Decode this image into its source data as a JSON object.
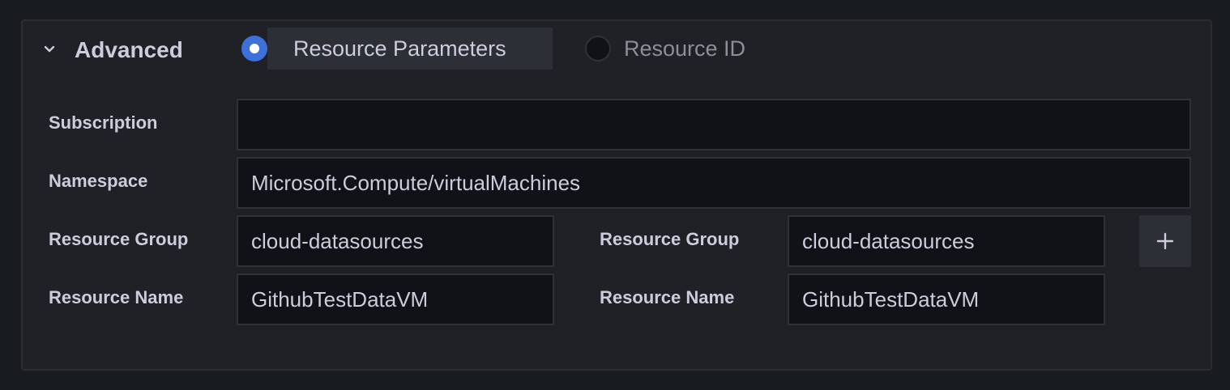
{
  "section": {
    "title": "Advanced",
    "icons": {
      "collapse": "chevron-down-icon",
      "add": "plus-icon"
    }
  },
  "mode": {
    "options": [
      "Resource Parameters",
      "Resource ID"
    ],
    "selected": "Resource Parameters"
  },
  "fields": {
    "subscription": {
      "label": "Subscription",
      "value": ""
    },
    "namespace": {
      "label": "Namespace",
      "value": "Microsoft.Compute/virtualMachines"
    },
    "resources": [
      {
        "group_label": "Resource Group",
        "group_value": "cloud-datasources",
        "name_label": "Resource Name",
        "name_value": "GithubTestDataVM"
      },
      {
        "group_label": "Resource Group",
        "group_value": "cloud-datasources",
        "name_label": "Resource Name",
        "name_value": "GithubTestDataVM"
      }
    ]
  },
  "colors": {
    "accent": "#3d71d9",
    "background": "#181b1f",
    "panel": "#1f2127",
    "input": "#111217",
    "text": "#ccccdc",
    "muted_text": "#8e8e96"
  }
}
